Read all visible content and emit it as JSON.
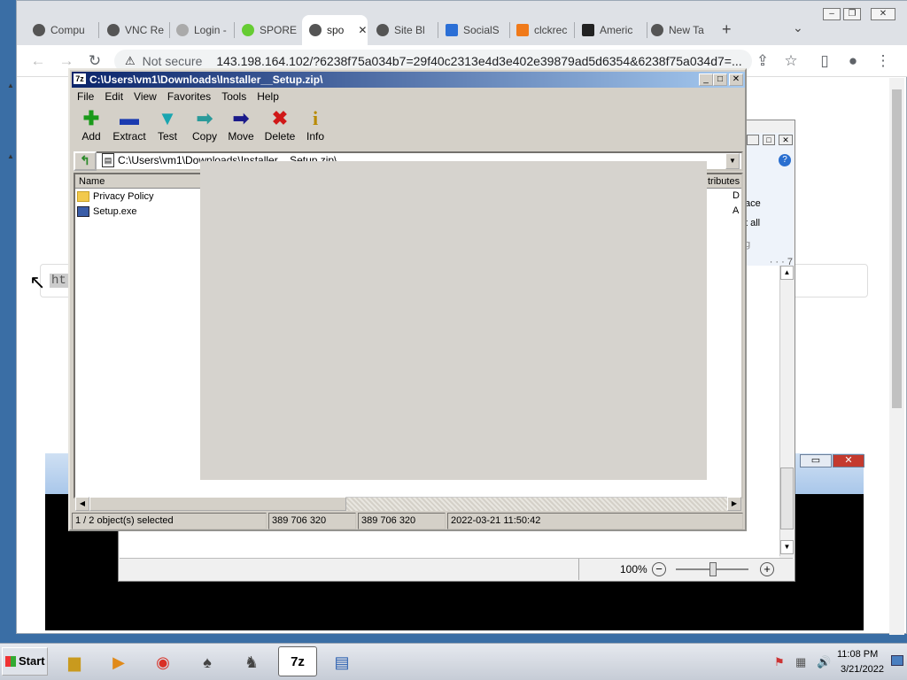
{
  "browser": {
    "tabs": [
      {
        "label": "Compu",
        "color": "#555"
      },
      {
        "label": "VNC Re",
        "color": "#555"
      },
      {
        "label": "Login -",
        "color": "#888"
      },
      {
        "label": "SPORE",
        "color": "#6c3"
      },
      {
        "label": "spo",
        "color": "#555",
        "active": true
      },
      {
        "label": "Site Bl",
        "color": "#555"
      },
      {
        "label": "SocialS",
        "color": "#2b6fd6"
      },
      {
        "label": "clckrec",
        "color": "#f07a1a"
      },
      {
        "label": "Americ",
        "color": "#222"
      },
      {
        "label": "New Ta",
        "color": "#555"
      }
    ],
    "close_tab": "✕",
    "new_tab": "+",
    "tab_menu": "⌄",
    "security_label": "Not secure",
    "url": "143.198.164.102/?6238f75a034b7=29f40c2313e4d3e402e39879ad5d6354&6238f75a034d7=...",
    "url_field_text": "ht"
  },
  "sevenzip": {
    "title": "C:\\Users\\vm1\\Downloads\\Installer__Setup.zip\\",
    "title_icon": "7z",
    "menu": [
      "File",
      "Edit",
      "View",
      "Favorites",
      "Tools",
      "Help"
    ],
    "toolbar": [
      {
        "label": "Add",
        "glyph": "✚",
        "color": "#1a9a1a"
      },
      {
        "label": "Extract",
        "glyph": "▬",
        "color": "#1a3ab0"
      },
      {
        "label": "Test",
        "glyph": "▼",
        "color": "#19a5b0"
      },
      {
        "label": "Copy",
        "glyph": "➡",
        "color": "#2a9a9a"
      },
      {
        "label": "Move",
        "glyph": "➡",
        "color": "#1a1a8a"
      },
      {
        "label": "Delete",
        "glyph": "✖",
        "color": "#d01818"
      },
      {
        "label": "Info",
        "glyph": "i",
        "color": "#b88a00"
      }
    ],
    "path": "C:\\Users\\vm1\\Downloads\\Installer__Setup.zip\\",
    "columns": {
      "name": "Name",
      "attributes": "tributes"
    },
    "files": [
      {
        "name": "Privacy Policy",
        "attr": "D",
        "type": "folder"
      },
      {
        "name": "Setup.exe",
        "attr": "A",
        "type": "exe"
      }
    ],
    "status": {
      "selected": "1 / 2 object(s) selected",
      "size": "389 706 320",
      "packed": "389 706 320",
      "modified": "2022-03-21 11:50:42"
    }
  },
  "wordpad": {
    "ribbon_replace": "ace",
    "ribbon_select_all": "t all",
    "ribbon_editing": "g",
    "ruler_end": "7",
    "zoom": "100%"
  },
  "taskbar": {
    "start_label": "Start",
    "time": "11:08 PM",
    "date": "3/21/2022"
  },
  "colors": {
    "title_active": "#0a246a",
    "overlay": "#d6d3ce"
  }
}
